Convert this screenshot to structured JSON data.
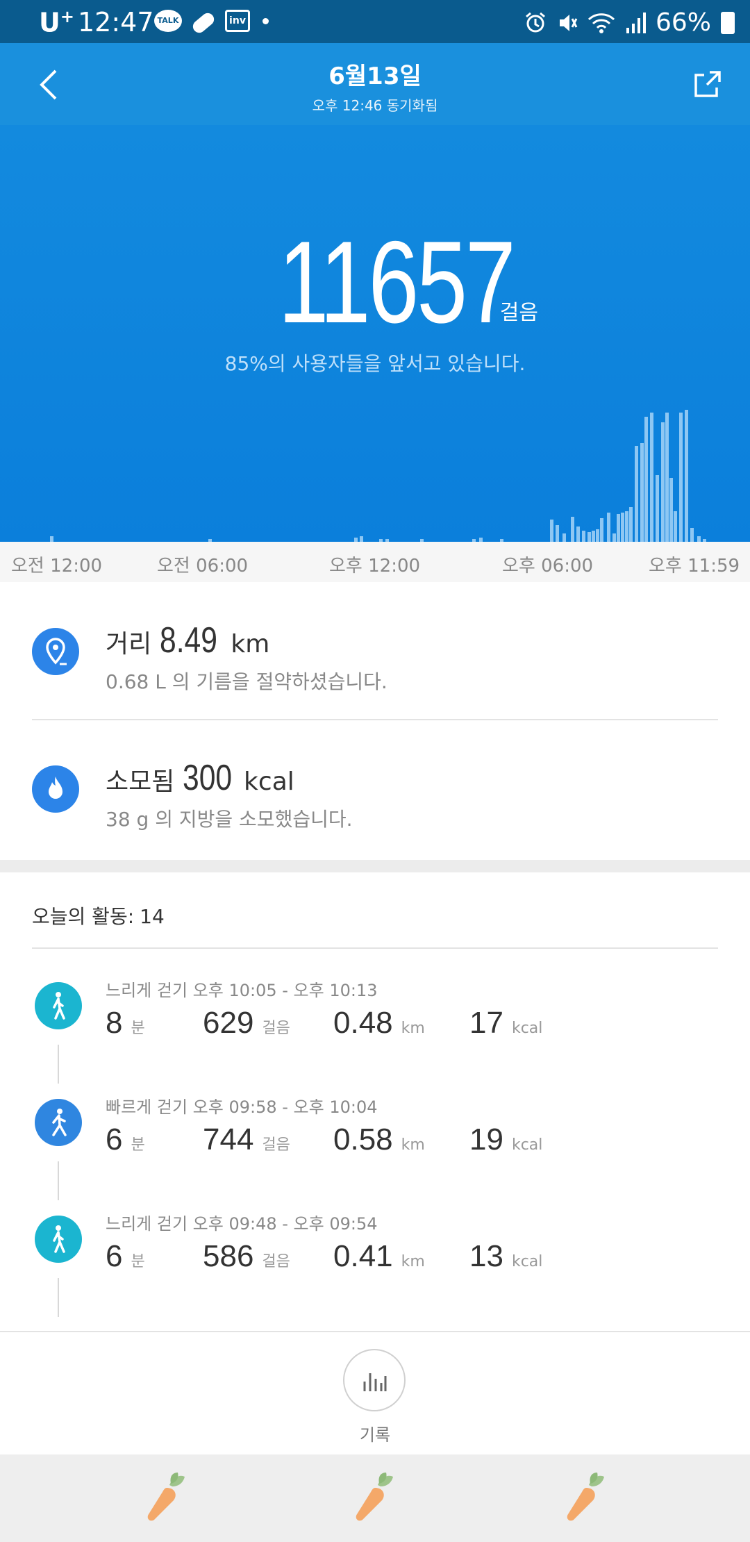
{
  "status_bar": {
    "carrier": "U",
    "carrier_sup": "+",
    "time": "12:47",
    "icons": [
      "talk-icon",
      "pill-icon",
      "inv-icon",
      "dot-icon"
    ],
    "talk_text": "TALK",
    "inv_text": "inv",
    "battery_pct": "66%",
    "right_icons": [
      "alarm-icon",
      "mute-icon",
      "wifi-icon",
      "signal-icon",
      "battery-icon"
    ]
  },
  "header": {
    "title": "6월13일",
    "subtitle": "오후 12:46 동기화됨",
    "back_icon": "back-chevron-icon",
    "share_icon": "share-icon"
  },
  "hero": {
    "steps": "11657",
    "steps_unit": "걸음",
    "rank_text": "85%의 사용자들을 앞서고 있습니다.",
    "bar_color": "#8ec7f3",
    "background": "#138ade"
  },
  "time_axis": {
    "labels": [
      "오전 12:00",
      "오전 06:00",
      "오후 12:00",
      "오후 06:00",
      "오후 11:59"
    ]
  },
  "stats": {
    "distance": {
      "label": "거리",
      "value": "8.49",
      "unit": "km",
      "sub": "0.68 L 의 기름을 절약하셨습니다.",
      "icon": "location-pin-icon"
    },
    "calories": {
      "label": "소모됨",
      "value": "300",
      "unit": "kcal",
      "sub": "38 g 의 지방을 소모했습니다.",
      "icon": "flame-icon"
    }
  },
  "activities": {
    "header_label": "오늘의 활동:",
    "count": "14",
    "items": [
      {
        "label": "느리게 걷기 오후 10:05 - 오후 10:13",
        "minutes": "8",
        "min_unit": "분",
        "steps": "629",
        "steps_unit": "걸음",
        "km": "0.48",
        "km_unit": "km",
        "kcal": "17",
        "kcal_unit": "kcal",
        "icon_color": "#1bb5d0"
      },
      {
        "label": "빠르게 걷기 오후 09:58 - 오후 10:04",
        "minutes": "6",
        "min_unit": "분",
        "steps": "744",
        "steps_unit": "걸음",
        "km": "0.58",
        "km_unit": "km",
        "kcal": "19",
        "kcal_unit": "kcal",
        "icon_color": "#2f86e0"
      },
      {
        "label": "느리게 걷기 오후 09:48 - 오후 09:54",
        "minutes": "6",
        "min_unit": "분",
        "steps": "586",
        "steps_unit": "걸음",
        "km": "0.41",
        "km_unit": "km",
        "kcal": "13",
        "kcal_unit": "kcal",
        "icon_color": "#1bb5d0"
      }
    ]
  },
  "record": {
    "label": "기록",
    "icon": "bar-chart-icon"
  },
  "bottom_bar": {
    "icons": [
      "carrot-icon",
      "carrot-icon",
      "carrot-icon"
    ]
  }
}
